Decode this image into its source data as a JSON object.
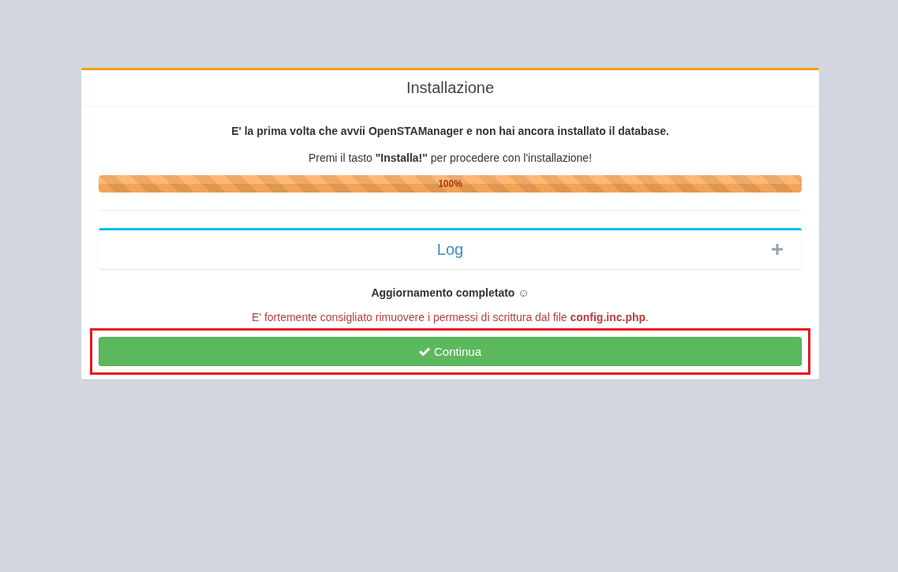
{
  "box": {
    "title": "Installazione"
  },
  "intro": "E' la prima volta che avvii OpenSTAManager e non hai ancora installato il database.",
  "instruction": "Premi il tasto **\"Installa!\"** per procedere con l'installazione!",
  "progress": {
    "level": 1,
    "reading": "100%"
  },
  "log_panel": {
    "title": "Log",
    "expanded": false
  },
  "status": "Aggiornamento completato ☺",
  "warning": "E' fortemente consigliato rimuovere i permessi di scrittura dal file **config.inc.php**.",
  "continue_button": {
    "label": "Continua",
    "highlighted": true
  }
}
